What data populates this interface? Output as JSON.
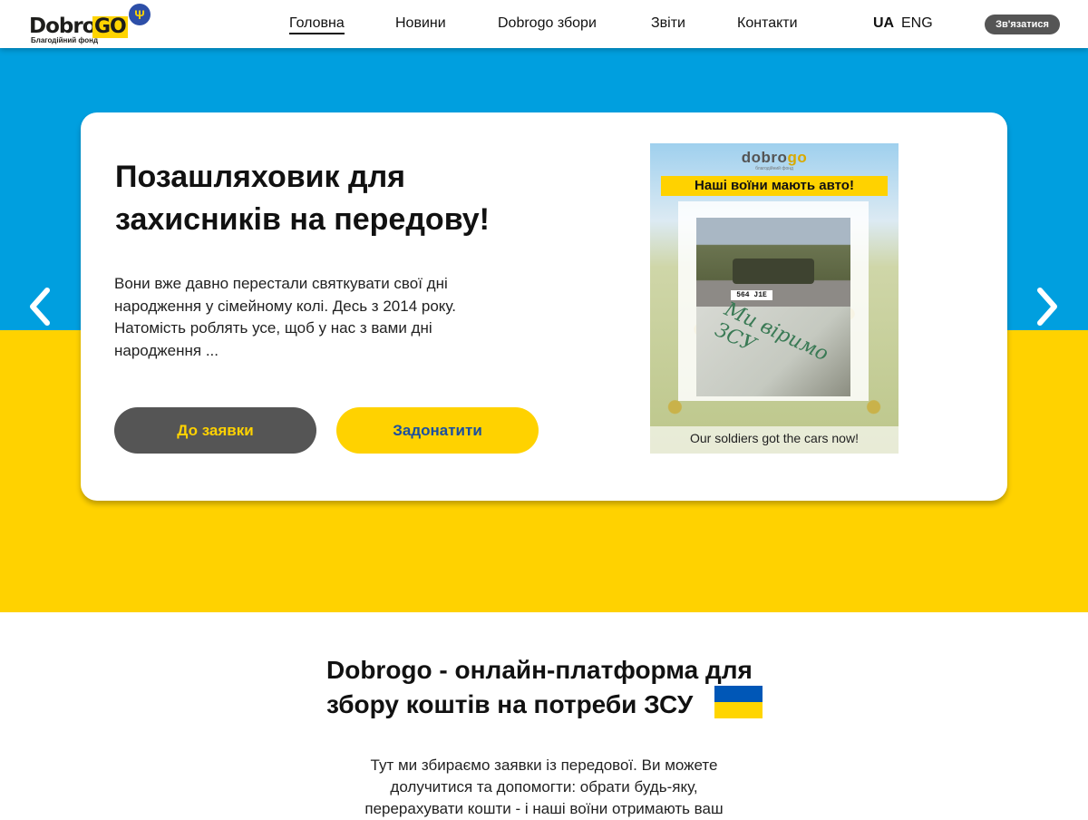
{
  "header": {
    "logo": {
      "word": "Dobro",
      "accent": "GO",
      "subtitle": "Благодійний фонд"
    },
    "nav": [
      "Головна",
      "Новини",
      "Dobrogo збори",
      "Звіти",
      "Контакти"
    ],
    "lang_ua": "UA",
    "lang_eng": "ENG",
    "contact_button": "Зв'язатися"
  },
  "hero": {
    "title": "Позашляховик для захисників на передову!",
    "text": "Вони вже давно перестали святкувати свої дні народження у сімейному колі. Десь з 2014 року. Натомість роблять усе, щоб у нас з вами дні народження ...",
    "button_request": "До заявки",
    "button_donate": "Задонатити",
    "poster": {
      "logo_main": "dobro",
      "logo_accent": "go",
      "logo_sub": "благодійний фонд",
      "banner": "Наші воїни мають авто!",
      "plate": "564 J1E",
      "handwriting": "Ми віримо ЗСУ",
      "caption": "Our soldiers got the cars now!"
    }
  },
  "about": {
    "title": "Dobrogo - онлайн-платформа для збору коштів на потреби ЗСУ",
    "text": "Тут ми збираємо заявки із передової. Ви можете долучитися та допомогти: обрати будь-яку, перерахувати кошти - і наші воїни  отримають ваш"
  },
  "colors": {
    "blue": "#009fdf",
    "yellow": "#ffd200",
    "dark_button": "#555555"
  }
}
